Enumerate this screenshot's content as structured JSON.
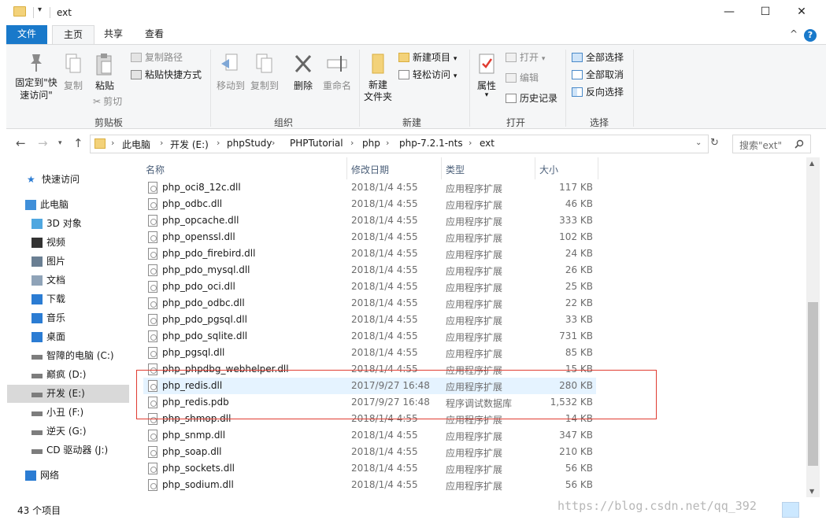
{
  "window": {
    "title": "ext",
    "minimize": "—",
    "maximize": "☐",
    "close": "✕"
  },
  "ribbon_tabs": [
    "文件",
    "主页",
    "共享",
    "查看"
  ],
  "ribbon": {
    "groups": {
      "clipboard": "剪贴板",
      "organize": "组织",
      "new": "新建",
      "open": "打开",
      "select": "选择"
    },
    "pin_quick_access": "固定到\"快速访问\"",
    "copy": "复制",
    "paste": "粘贴",
    "copy_path": "复制路径",
    "paste_shortcut": "粘贴快捷方式",
    "cut": "剪切",
    "move_to": "移动到",
    "copy_to": "复制到",
    "delete": "删除",
    "rename": "重命名",
    "new_folder": "新建\n文件夹",
    "new_item": "新建项目",
    "easy_access": "轻松访问",
    "properties": "属性",
    "open": "打开",
    "edit": "编辑",
    "history": "历史记录",
    "select_all": "全部选择",
    "select_none": "全部取消",
    "invert_selection": "反向选择"
  },
  "address": {
    "crumbs": [
      "此电脑",
      "开发 (E:)",
      "phpStudy",
      "PHPTutorial",
      "php",
      "php-7.2.1-nts",
      "ext"
    ],
    "search_placeholder": "搜索\"ext\""
  },
  "nav_pane": [
    {
      "label": "快速访问",
      "icon": "star-icon",
      "selected": false
    },
    {
      "label": "此电脑",
      "icon": "computer-icon",
      "selected": false
    },
    {
      "label": "3D 对象",
      "icon": "cube-icon",
      "selected": false
    },
    {
      "label": "视频",
      "icon": "video-icon",
      "selected": false
    },
    {
      "label": "图片",
      "icon": "picture-icon",
      "selected": false
    },
    {
      "label": "文档",
      "icon": "document-icon",
      "selected": false
    },
    {
      "label": "下载",
      "icon": "download-icon",
      "selected": false
    },
    {
      "label": "音乐",
      "icon": "music-icon",
      "selected": false
    },
    {
      "label": "桌面",
      "icon": "desktop-icon",
      "selected": false
    },
    {
      "label": "智障的电脑 (C:)",
      "icon": "drive-icon",
      "selected": false
    },
    {
      "label": "巅疯 (D:)",
      "icon": "drive-icon",
      "selected": false
    },
    {
      "label": "开发 (E:)",
      "icon": "drive-icon",
      "selected": true
    },
    {
      "label": "小丑 (F:)",
      "icon": "drive-icon",
      "selected": false
    },
    {
      "label": "逆天 (G:)",
      "icon": "drive-icon",
      "selected": false
    },
    {
      "label": "CD 驱动器 (J:)",
      "icon": "cd-drive-icon",
      "selected": false
    },
    {
      "label": "网络",
      "icon": "network-icon",
      "selected": false
    }
  ],
  "columns": [
    "名称",
    "修改日期",
    "类型",
    "大小"
  ],
  "files": [
    {
      "name": "php_oci8_12c.dll",
      "date": "2018/1/4 4:55",
      "type": "应用程序扩展",
      "size": "117 KB"
    },
    {
      "name": "php_odbc.dll",
      "date": "2018/1/4 4:55",
      "type": "应用程序扩展",
      "size": "46 KB"
    },
    {
      "name": "php_opcache.dll",
      "date": "2018/1/4 4:55",
      "type": "应用程序扩展",
      "size": "333 KB"
    },
    {
      "name": "php_openssl.dll",
      "date": "2018/1/4 4:55",
      "type": "应用程序扩展",
      "size": "102 KB"
    },
    {
      "name": "php_pdo_firebird.dll",
      "date": "2018/1/4 4:55",
      "type": "应用程序扩展",
      "size": "24 KB"
    },
    {
      "name": "php_pdo_mysql.dll",
      "date": "2018/1/4 4:55",
      "type": "应用程序扩展",
      "size": "26 KB"
    },
    {
      "name": "php_pdo_oci.dll",
      "date": "2018/1/4 4:55",
      "type": "应用程序扩展",
      "size": "25 KB"
    },
    {
      "name": "php_pdo_odbc.dll",
      "date": "2018/1/4 4:55",
      "type": "应用程序扩展",
      "size": "22 KB"
    },
    {
      "name": "php_pdo_pgsql.dll",
      "date": "2018/1/4 4:55",
      "type": "应用程序扩展",
      "size": "33 KB"
    },
    {
      "name": "php_pdo_sqlite.dll",
      "date": "2018/1/4 4:55",
      "type": "应用程序扩展",
      "size": "731 KB"
    },
    {
      "name": "php_pgsql.dll",
      "date": "2018/1/4 4:55",
      "type": "应用程序扩展",
      "size": "85 KB"
    },
    {
      "name": "php_phpdbg_webhelper.dll",
      "date": "2018/1/4 4:55",
      "type": "应用程序扩展",
      "size": "15 KB"
    },
    {
      "name": "php_redis.dll",
      "date": "2017/9/27 16:48",
      "type": "应用程序扩展",
      "size": "280 KB",
      "selected": true
    },
    {
      "name": "php_redis.pdb",
      "date": "2017/9/27 16:48",
      "type": "程序调试数据库",
      "size": "1,532 KB"
    },
    {
      "name": "php_shmop.dll",
      "date": "2018/1/4 4:55",
      "type": "应用程序扩展",
      "size": "14 KB"
    },
    {
      "name": "php_snmp.dll",
      "date": "2018/1/4 4:55",
      "type": "应用程序扩展",
      "size": "347 KB"
    },
    {
      "name": "php_soap.dll",
      "date": "2018/1/4 4:55",
      "type": "应用程序扩展",
      "size": "210 KB"
    },
    {
      "name": "php_sockets.dll",
      "date": "2018/1/4 4:55",
      "type": "应用程序扩展",
      "size": "56 KB"
    },
    {
      "name": "php_sodium.dll",
      "date": "2018/1/4 4:55",
      "type": "应用程序扩展",
      "size": "56 KB"
    }
  ],
  "status": {
    "count": "43 个项目"
  },
  "watermark": "https://blog.csdn.net/qq_392",
  "colors": {
    "accent": "#1979ca",
    "selection": "#e5f3ff",
    "highlight_box": "#e03c31"
  }
}
